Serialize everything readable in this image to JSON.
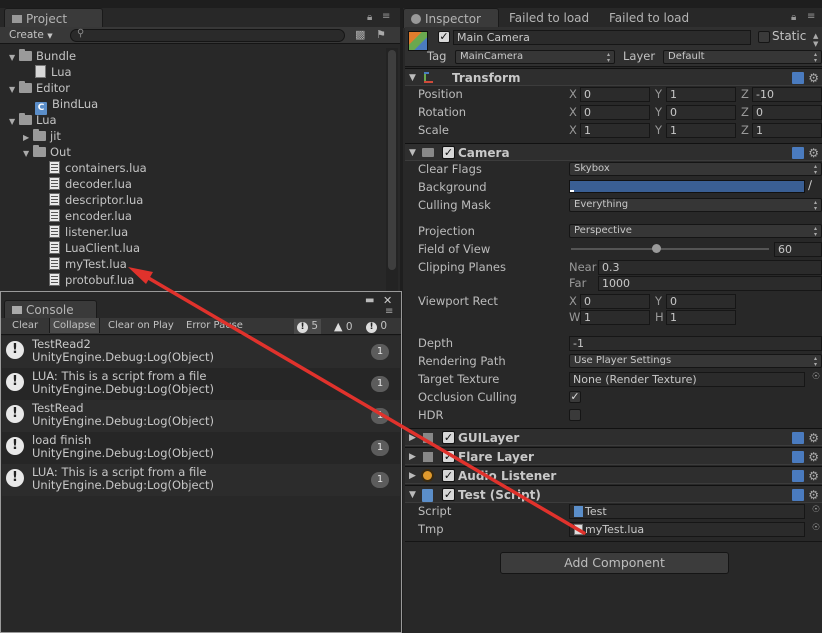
{
  "project": {
    "tab_label": "Project",
    "create_label": "Create",
    "tree": [
      {
        "label": "Bundle",
        "type": "folder",
        "expanded": true
      },
      {
        "label": "Lua",
        "type": "file"
      },
      {
        "label": "Editor",
        "type": "folder",
        "expanded": true
      },
      {
        "label": "BindLua",
        "type": "cs"
      },
      {
        "label": "Lua",
        "type": "folder",
        "expanded": true
      },
      {
        "label": "jit",
        "type": "folder",
        "expanded": false
      },
      {
        "label": "Out",
        "type": "folder",
        "expanded": true
      },
      {
        "label": "containers.lua",
        "type": "lua"
      },
      {
        "label": "decoder.lua",
        "type": "lua"
      },
      {
        "label": "descriptor.lua",
        "type": "lua"
      },
      {
        "label": "encoder.lua",
        "type": "lua"
      },
      {
        "label": "listener.lua",
        "type": "lua"
      },
      {
        "label": "LuaClient.lua",
        "type": "lua"
      },
      {
        "label": "myTest.lua",
        "type": "lua"
      },
      {
        "label": "protobuf.lua",
        "type": "lua"
      }
    ]
  },
  "console": {
    "tab_label": "Console",
    "toolbar": {
      "clear": "Clear",
      "collapse": "Collapse",
      "clear_on_play": "Clear on Play",
      "error_pause": "Error Pause",
      "warn_count": "5",
      "error_count": "0",
      "info_count": "0"
    },
    "entries": [
      {
        "line1": "TestRead2",
        "line2": "UnityEngine.Debug:Log(Object)",
        "count": "1"
      },
      {
        "line1": "LUA: This is a script from a file",
        "line2": "UnityEngine.Debug:Log(Object)",
        "count": "1"
      },
      {
        "line1": "TestRead",
        "line2": "UnityEngine.Debug:Log(Object)",
        "count": "1"
      },
      {
        "line1": "load finish",
        "line2": "UnityEngine.Debug:Log(Object)",
        "count": "1"
      },
      {
        "line1": "LUA: This is a script from a file",
        "line2": "UnityEngine.Debug:Log(Object)",
        "count": "1"
      }
    ]
  },
  "inspector": {
    "tabs": [
      "Inspector",
      "Failed to load",
      "Failed to load"
    ],
    "object_name": "Main Camera",
    "static_label": "Static",
    "tag_label": "Tag",
    "tag_value": "MainCamera",
    "layer_label": "Layer",
    "layer_value": "Default",
    "transform": {
      "title": "Transform",
      "position_label": "Position",
      "rotation_label": "Rotation",
      "scale_label": "Scale",
      "position": {
        "x": "0",
        "y": "1",
        "z": "-10"
      },
      "rotation": {
        "x": "0",
        "y": "0",
        "z": "0"
      },
      "scale": {
        "x": "1",
        "y": "1",
        "z": "1"
      },
      "axis_x": "X",
      "axis_y": "Y",
      "axis_z": "Z"
    },
    "camera": {
      "title": "Camera",
      "clear_flags_label": "Clear Flags",
      "clear_flags": "Skybox",
      "background_label": "Background",
      "background_color": "#3a5f94",
      "culling_mask_label": "Culling Mask",
      "culling_mask": "Everything",
      "projection_label": "Projection",
      "projection": "Perspective",
      "fov_label": "Field of View",
      "fov": "60",
      "fov_fraction": 0.43,
      "clipping_label": "Clipping Planes",
      "near_label": "Near",
      "near": "0.3",
      "far_label": "Far",
      "far": "1000",
      "viewport_label": "Viewport Rect",
      "vp_x_label": "X",
      "vp_x": "0",
      "vp_y_label": "Y",
      "vp_y": "0",
      "vp_w_label": "W",
      "vp_w": "1",
      "vp_h_label": "H",
      "vp_h": "1",
      "depth_label": "Depth",
      "depth": "-1",
      "rendering_path_label": "Rendering Path",
      "rendering_path": "Use Player Settings",
      "target_texture_label": "Target Texture",
      "target_texture": "None (Render Texture)",
      "occlusion_label": "Occlusion Culling",
      "hdr_label": "HDR"
    },
    "components": {
      "gui_layer": "GUILayer",
      "flare_layer": "Flare Layer",
      "audio_listener": "Audio Listener",
      "test_script": "Test (Script)"
    },
    "test_script": {
      "script_label": "Script",
      "script_value": "Test",
      "tmp_label": "Tmp",
      "tmp_value": "myTest.lua"
    },
    "add_component": "Add Component"
  },
  "colors": {
    "arrow": "#e0322c",
    "accent_blue": "#4a7bbf"
  }
}
